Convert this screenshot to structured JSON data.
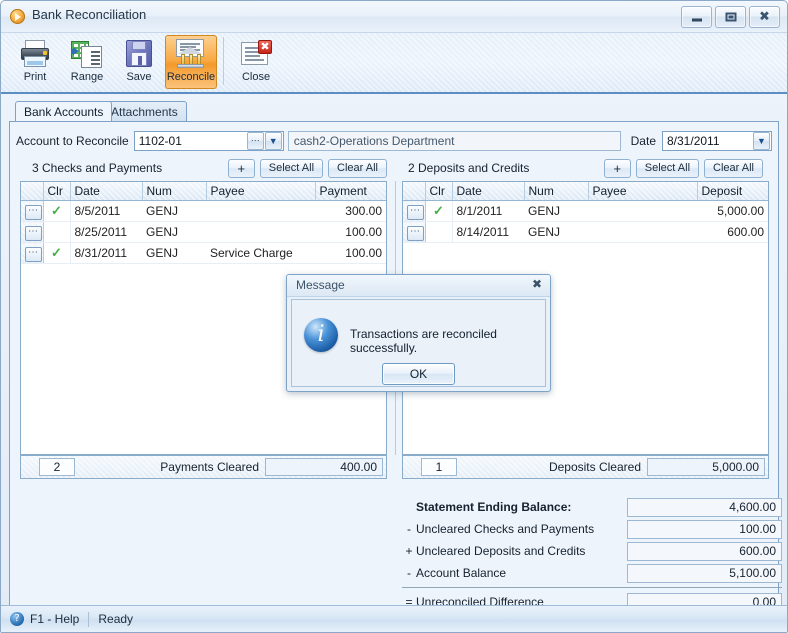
{
  "window": {
    "title": "Bank Reconciliation",
    "icon": "play-circle-icon",
    "buttons": {
      "minimize": "minimize-icon",
      "maximize": "maximize-icon",
      "close": "close-icon"
    }
  },
  "toolbar": {
    "items": [
      {
        "label": "Print",
        "icon": "printer-icon",
        "active": false
      },
      {
        "label": "Range",
        "icon": "range-grid-icon",
        "active": false
      },
      {
        "label": "Save",
        "icon": "floppy-disk-icon",
        "active": false
      },
      {
        "label": "Reconcile",
        "icon": "bank-icon",
        "active": true
      },
      {
        "label": "Close",
        "icon": "document-close-icon",
        "active": false
      }
    ]
  },
  "tabs": [
    {
      "label": "Bank Accounts",
      "selected": true
    },
    {
      "label": "Attachments",
      "selected": false
    }
  ],
  "account": {
    "label": "Account to Reconcile",
    "value": "1102-01",
    "description": "cash2-Operations Department",
    "lookup_icon": "ellipsis-icon",
    "dropdown_icon": "chevron-down-icon",
    "date_label": "Date",
    "date_value": "8/31/2011",
    "date_dropdown_icon": "chevron-down-icon"
  },
  "left_panel": {
    "title": "3 Checks and Payments",
    "add_label": "+",
    "select_all_label": "Select All",
    "clear_all_label": "Clear All",
    "columns": [
      "",
      "Clr",
      "Date",
      "Num",
      "Payee",
      "Payment"
    ],
    "rows": [
      {
        "row_icon": "ellipsis-icon",
        "cleared": true,
        "clr_icon": "check-icon",
        "date": "8/5/2011",
        "num": "GENJ",
        "payee": "",
        "amount": "300.00"
      },
      {
        "row_icon": "ellipsis-icon",
        "cleared": false,
        "clr_icon": "",
        "date": "8/25/2011",
        "num": "GENJ",
        "payee": "",
        "amount": "100.00"
      },
      {
        "row_icon": "ellipsis-icon",
        "cleared": true,
        "clr_icon": "check-icon",
        "date": "8/31/2011",
        "num": "GENJ",
        "payee": "Service Charge",
        "amount": "100.00"
      }
    ],
    "footer_count": "2",
    "footer_label": "Payments Cleared",
    "footer_value": "400.00"
  },
  "right_panel": {
    "title": "2 Deposits and Credits",
    "add_label": "+",
    "select_all_label": "Select All",
    "clear_all_label": "Clear All",
    "columns": [
      "",
      "Clr",
      "Date",
      "Num",
      "Payee",
      "Deposit"
    ],
    "rows": [
      {
        "row_icon": "ellipsis-icon",
        "cleared": true,
        "clr_icon": "check-icon",
        "date": "8/1/2011",
        "num": "GENJ",
        "payee": "",
        "amount": "5,000.00"
      },
      {
        "row_icon": "ellipsis-icon",
        "cleared": false,
        "clr_icon": "",
        "date": "8/14/2011",
        "num": "GENJ",
        "payee": "",
        "amount": "600.00"
      }
    ],
    "footer_count": "1",
    "footer_label": "Deposits Cleared",
    "footer_value": "5,000.00"
  },
  "summary": {
    "rows": [
      {
        "sign": "",
        "label": "Statement Ending Balance:",
        "value": "4,600.00",
        "bold": true
      },
      {
        "sign": "-",
        "label": "Uncleared Checks and Payments",
        "value": "100.00",
        "bold": false
      },
      {
        "sign": "+",
        "label": "Uncleared Deposits and Credits",
        "value": "600.00",
        "bold": false
      },
      {
        "sign": "-",
        "label": "Account Balance",
        "value": "5,100.00",
        "bold": false
      }
    ],
    "final": {
      "sign": "=",
      "label": "Unreconciled Difference",
      "value": "0.00"
    }
  },
  "dialog": {
    "title": "Message",
    "close_icon": "close-icon",
    "info_icon": "info-icon",
    "message": "Transactions are reconciled successfully.",
    "ok_label": "OK"
  },
  "statusbar": {
    "help_icon": "question-circle-icon",
    "help_label": "F1 - Help",
    "status": "Ready"
  },
  "colors": {
    "accent_orange": "#f39a2c",
    "frame_blue": "#7fa3c6",
    "check_green": "#46ae46",
    "info_blue": "#1c5fa8"
  }
}
